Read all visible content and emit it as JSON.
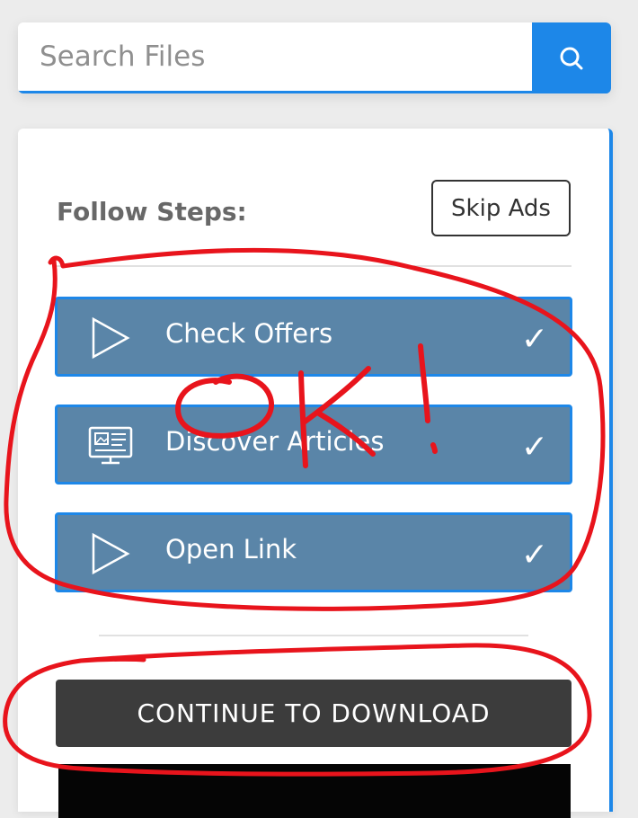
{
  "search": {
    "placeholder": "Search Files",
    "button_icon": "search-icon",
    "accent_color": "#1d87e8"
  },
  "steps_card": {
    "title": "Follow Steps:",
    "skip_label": "Skip Ads",
    "steps": [
      {
        "label": "Check Offers",
        "icon": "play-icon",
        "status": "✓"
      },
      {
        "label": "Discover Articles",
        "icon": "desktop-icon",
        "status": "✓"
      },
      {
        "label": "Open Link",
        "icon": "play-icon",
        "status": "✓"
      }
    ],
    "step_color": "#5a85a8",
    "continue_label": "CONTINUE TO DOWNLOAD",
    "continue_color": "#3c3c3c"
  },
  "annotation": {
    "handwritten_text": "OK!",
    "color": "#e8141c"
  }
}
